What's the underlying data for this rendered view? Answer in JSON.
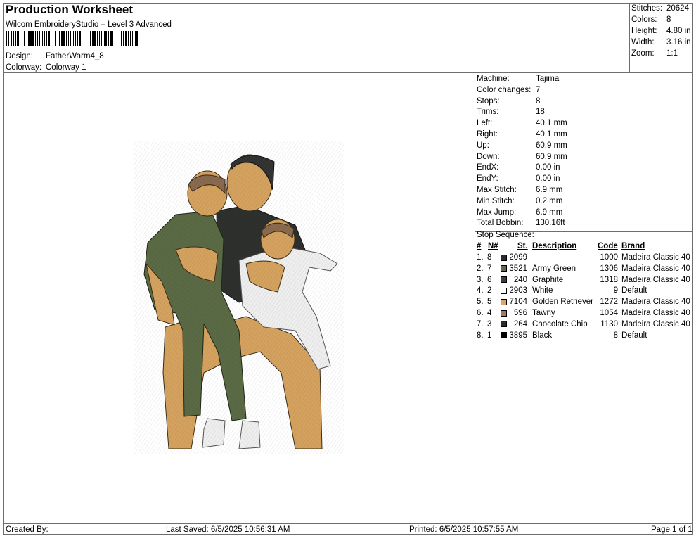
{
  "header": {
    "title": "Production Worksheet",
    "subtitle": "Wilcom EmbroideryStudio – Level 3 Advanced",
    "design_label": "Design:",
    "design_value": "FatherWarm4_8",
    "colorway_label": "Colorway:",
    "colorway_value": "Colorway 1"
  },
  "summary": [
    {
      "label": "Stitches:",
      "value": "20624"
    },
    {
      "label": "Colors:",
      "value": "8"
    },
    {
      "label": "Height:",
      "value": "4.80 in"
    },
    {
      "label": "Width:",
      "value": "3.16 in"
    },
    {
      "label": "Zoom:",
      "value": "1:1"
    }
  ],
  "machine_info": [
    {
      "label": "Machine:",
      "value": "Tajima"
    },
    {
      "label": "Color changes:",
      "value": "7"
    },
    {
      "label": "Stops:",
      "value": "8"
    },
    {
      "label": "Trims:",
      "value": "18"
    },
    {
      "label": "Left:",
      "value": "40.1 mm"
    },
    {
      "label": "Right:",
      "value": "40.1 mm"
    },
    {
      "label": "Up:",
      "value": "60.9 mm"
    },
    {
      "label": "Down:",
      "value": "60.9 mm"
    },
    {
      "label": "EndX:",
      "value": "0.00 in"
    },
    {
      "label": "EndY:",
      "value": "0.00 in"
    },
    {
      "label": "Max Stitch:",
      "value": "6.9 mm"
    },
    {
      "label": "Min Stitch:",
      "value": "0.2 mm"
    },
    {
      "label": "Max Jump:",
      "value": "6.9 mm"
    },
    {
      "label": "Total Bobbin:",
      "value": "130.16ft"
    }
  ],
  "stop_sequence": {
    "title": "Stop Sequence:",
    "headers": {
      "num": "#",
      "n": "N#",
      "st": "St.",
      "desc": "Description",
      "code": "Code",
      "brand": "Brand"
    },
    "rows": [
      {
        "num": "1.",
        "n": "8",
        "color": "#2a2a2a",
        "st": "2099",
        "desc": "",
        "code": "1000",
        "brand": "Madeira Classic 40"
      },
      {
        "num": "2.",
        "n": "7",
        "color": "#5d6b4c",
        "st": "3521",
        "desc": "Army Green",
        "code": "1306",
        "brand": "Madeira Classic 40"
      },
      {
        "num": "3.",
        "n": "6",
        "color": "#3d3f3f",
        "st": "240",
        "desc": "Graphite",
        "code": "1318",
        "brand": "Madeira Classic 40"
      },
      {
        "num": "4.",
        "n": "2",
        "color": "#ffffff",
        "st": "2903",
        "desc": "White",
        "code": "9",
        "brand": "Default"
      },
      {
        "num": "5.",
        "n": "5",
        "color": "#d9a868",
        "st": "7104",
        "desc": "Golden Retriever",
        "code": "1272",
        "brand": "Madeira Classic 40"
      },
      {
        "num": "6.",
        "n": "4",
        "color": "#a07a64",
        "st": "596",
        "desc": "Tawny",
        "code": "1054",
        "brand": "Madeira Classic 40"
      },
      {
        "num": "7.",
        "n": "3",
        "color": "#2e2a28",
        "st": "264",
        "desc": "Chocolate Chip",
        "code": "1130",
        "brand": "Madeira Classic 40"
      },
      {
        "num": "8.",
        "n": "1",
        "color": "#000000",
        "st": "3895",
        "desc": "Black",
        "code": "8",
        "brand": "Default"
      }
    ]
  },
  "footer": {
    "created_by": "Created By:",
    "last_saved": "Last Saved: 6/5/2025 10:56:31 AM",
    "printed": "Printed: 6/5/2025 10:57:55 AM",
    "page": "Page 1 of 1"
  },
  "design_colors": {
    "skin": "#d4a25e",
    "green": "#5a6a44",
    "black": "#2b2b2b",
    "white": "#eeeeee",
    "hair_brown": "#8a6a4e"
  }
}
